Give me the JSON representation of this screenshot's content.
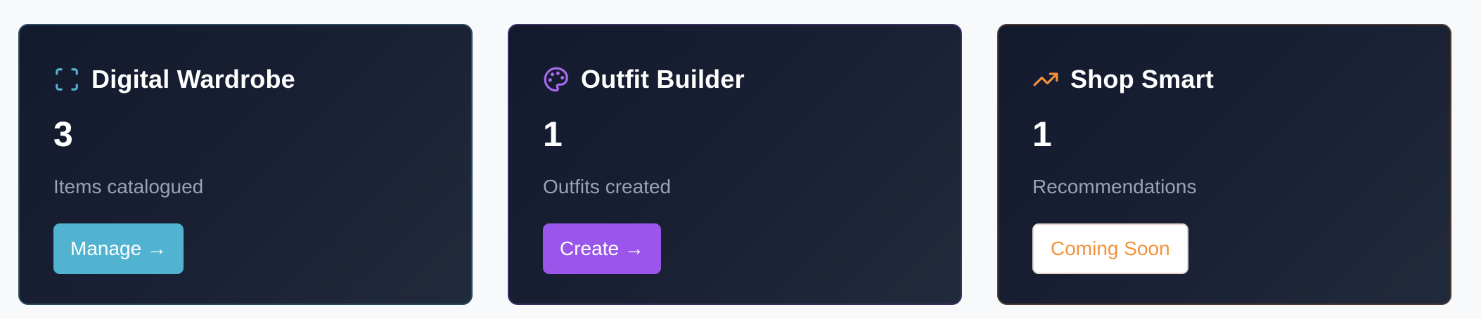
{
  "cards": [
    {
      "title": "Digital Wardrobe",
      "count": "3",
      "description": "Items catalogued",
      "button_label": "Manage →",
      "icon": "scan-icon",
      "accent": "#52b3d1"
    },
    {
      "title": "Outfit Builder",
      "count": "1",
      "description": "Outfits created",
      "button_label": "Create →",
      "icon": "palette-icon",
      "accent": "#9a56ea"
    },
    {
      "title": "Shop Smart",
      "count": "1",
      "description": "Recommendations",
      "button_label": "Coming Soon",
      "icon": "trending-up-icon",
      "accent": "#f3923b"
    }
  ],
  "colors": {
    "page_background": "#f8f9fb",
    "card_background": "#1a2034",
    "text_primary": "#ffffff",
    "text_secondary": "#9aa3b4"
  }
}
